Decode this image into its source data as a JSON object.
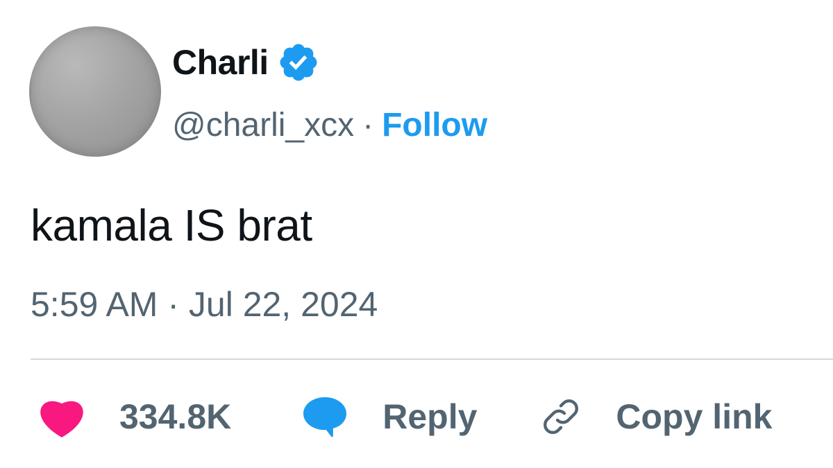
{
  "author": {
    "name": "Charli",
    "handle": "@charli_xcx",
    "separator": "·",
    "follow_label": "Follow",
    "verified_icon": "verified-badge-icon"
  },
  "tweet": {
    "text": "kamala IS brat",
    "timestamp": "5:59 AM · Jul 22, 2024"
  },
  "actions": {
    "likes_count": "334.8K",
    "reply_label": "Reply",
    "copy_link_label": "Copy link"
  },
  "colors": {
    "accent": "#1d9bf0",
    "like": "#f91880",
    "text_primary": "#0f1419",
    "text_secondary": "#536471",
    "divider": "#cfd9de"
  }
}
